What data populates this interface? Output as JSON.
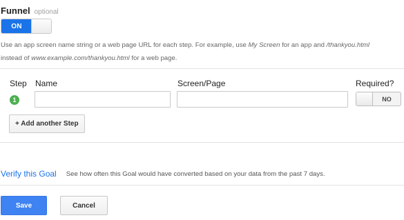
{
  "funnel": {
    "title": "Funnel",
    "optional_label": "optional",
    "toggle_label": "ON",
    "help_text_1": "Use an app screen name string or a web page URL for each step. For example, use ",
    "help_em_1": "My Screen",
    "help_text_2": " for an app and ",
    "help_em_2": "/thankyou.html",
    "help_text_3": "instead of ",
    "help_em_3": "www.example.com/thankyou.html",
    "help_text_4": " for a web page."
  },
  "steps_table": {
    "headers": {
      "step": "Step",
      "name": "Name",
      "screen_page": "Screen/Page",
      "required": "Required?"
    },
    "rows": [
      {
        "step_number": "1",
        "name_value": "",
        "screen_page_value": "",
        "required_label": "NO"
      }
    ],
    "add_step_label": "+ Add another Step"
  },
  "verify": {
    "link_label": "Verify this Goal",
    "description": "See how often this Goal would have converted based on your data from the past 7 days."
  },
  "actions": {
    "save_label": "Save",
    "cancel_label": "Cancel"
  },
  "colors": {
    "accent": "#1a73e8",
    "save_button": "#3f82f1",
    "step_badge": "#4caf50"
  }
}
